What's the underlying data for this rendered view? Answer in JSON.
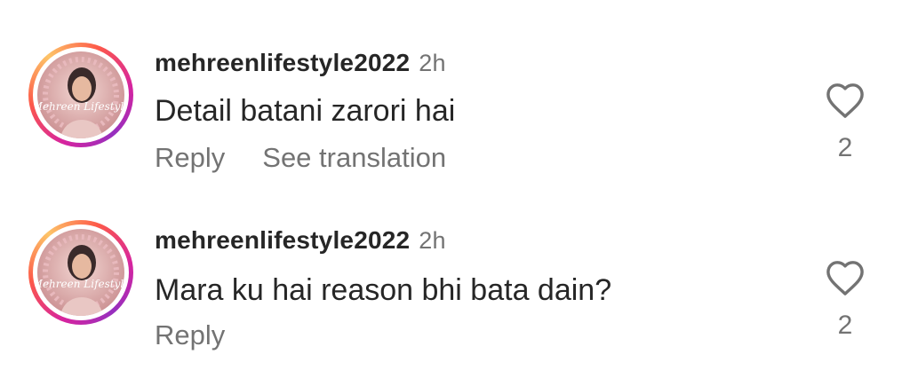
{
  "comments": [
    {
      "username": "mehreenlifestyle2022",
      "time": "2h",
      "text": "Detail batani zarori hai",
      "actions": {
        "reply": "Reply",
        "translate": "See translation"
      },
      "likes": "2",
      "avatar_icon": "profile-photo",
      "like_icon": "heart-outline-icon"
    },
    {
      "username": "mehreenlifestyle2022",
      "time": "2h",
      "text": "Mara ku hai reason bhi bata dain?",
      "actions": {
        "reply": "Reply"
      },
      "likes": "2",
      "avatar_icon": "profile-photo",
      "like_icon": "heart-outline-icon"
    }
  ],
  "colors": {
    "text_primary": "#262626",
    "text_secondary": "#737373",
    "story_ring": "#d6249f"
  }
}
